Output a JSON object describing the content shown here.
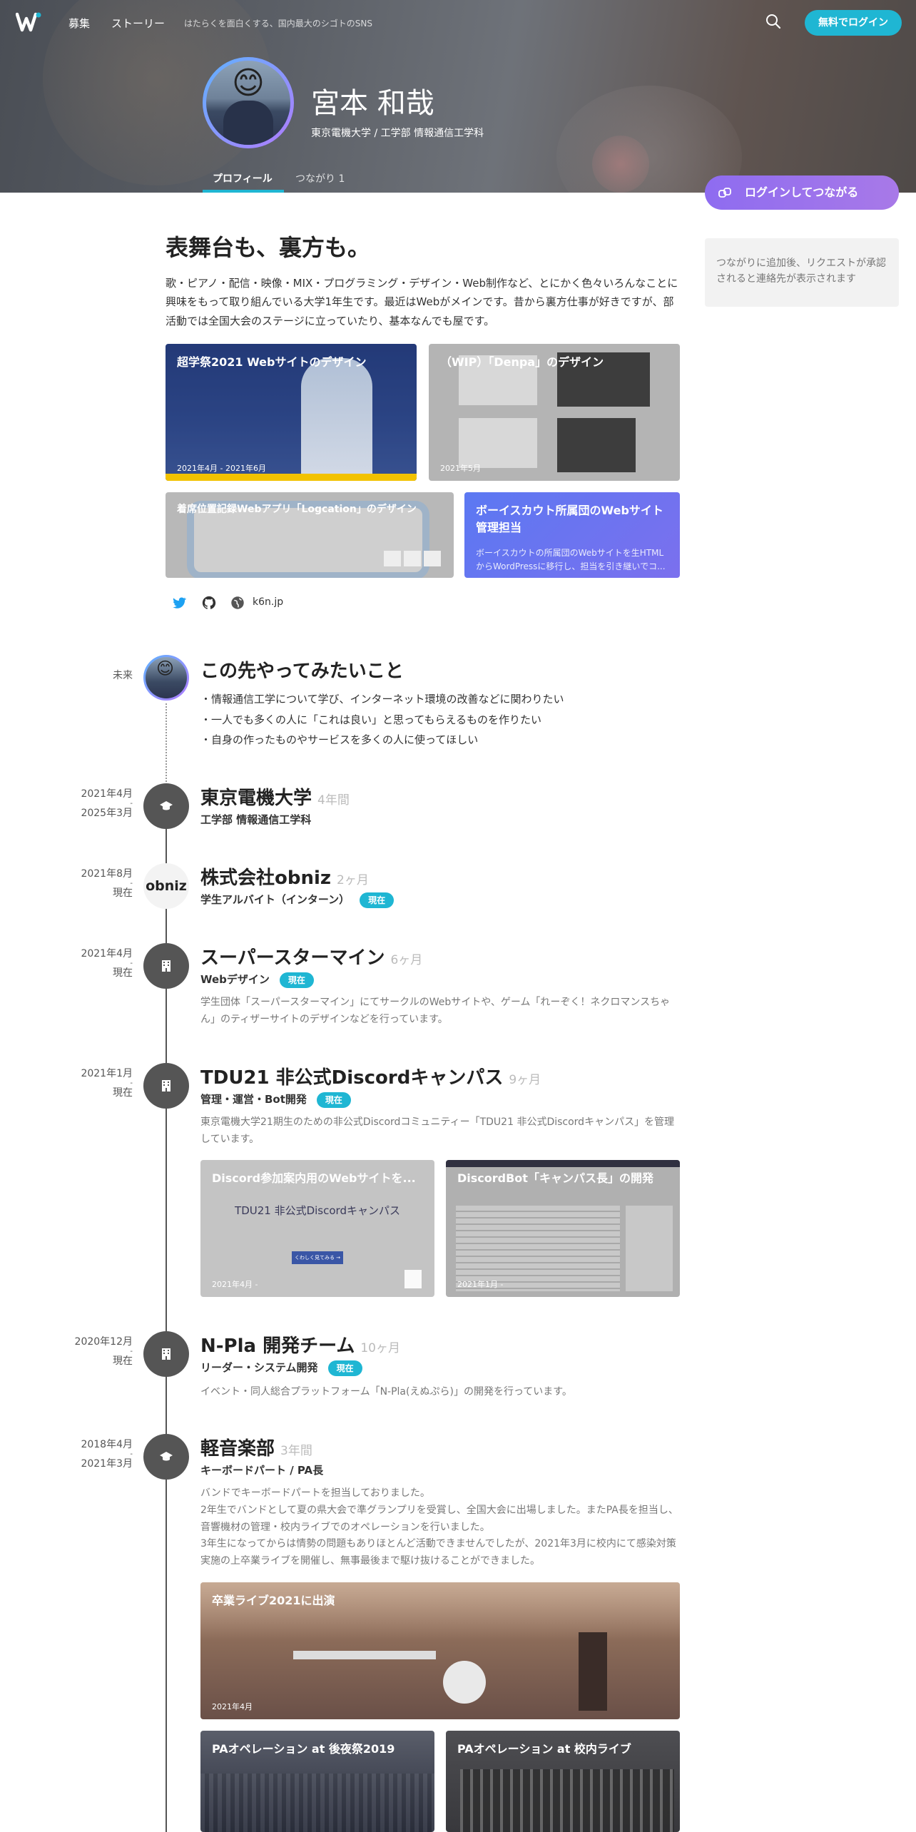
{
  "nav": {
    "links": [
      "募集",
      "ストーリー"
    ],
    "tagline": "はたらくを面白くする、国内最大のシゴトのSNS",
    "login": "無料でログイン"
  },
  "profile": {
    "name": "宮本 和哉",
    "school": "東京電機大学 / 工学部 情報通信工学科",
    "tabs": [
      "プロフィール",
      "つながり 1"
    ],
    "connect": "ログインしてつながる",
    "side_note": "つながりに追加後、リクエストが承認されると連絡先が表示されます"
  },
  "intro": {
    "catch": "表舞台も、裏方も。",
    "text": "歌・ピアノ・配信・映像・MIX・プログラミング・デザイン・Web制作など、とにかく色々いろんなことに興味をもって取り組んでいる大学1年生です。最近はWebがメインです。昔から裏方仕事が好きですが、部活動では全国大会のステージに立っていたり、基本なんでも屋です。",
    "cards": [
      {
        "title": "超学祭2021 Webサイトのデザイン",
        "date": "2021年4月 - 2021年6月"
      },
      {
        "title": "（WIP）「Denpa」のデザイン",
        "date": "2021年5月"
      },
      {
        "title": "着席位置記録Webアプリ「Logcation」のデザイン",
        "date": ""
      },
      {
        "title": "ボーイスカウト所属団のWebサイト管理担当",
        "desc": "ボーイスカウトの所属団のWebサイトを生HTMLからWordPressに移行し、担当を引き継いでコ..."
      }
    ],
    "url": "k6n.jp"
  },
  "timeline": {
    "future": {
      "date": "未来",
      "title": "この先やってみたいこと",
      "items": [
        "・情報通信工学について学び、インターネット環境の改善などに関わりたい",
        "・一人でも多くの人に「これは良い」と思ってもらえるものを作りたい",
        "・自身の作ったものやサービスを多くの人に使ってほしい"
      ]
    },
    "entries": [
      {
        "start": "2021年4月",
        "end": "2025年3月",
        "title": "東京電機大学",
        "duration": "4年間",
        "role": "工学部 情報通信工学科",
        "badge": "",
        "desc": ""
      },
      {
        "start": "2021年8月",
        "end": "現在",
        "title": "株式会社obniz",
        "duration": "2ヶ月",
        "role": "学生アルバイト（インターン）",
        "badge": "現在",
        "desc": ""
      },
      {
        "start": "2021年4月",
        "end": "現在",
        "title": "スーパースターマイン",
        "duration": "6ヶ月",
        "role": "Webデザイン",
        "badge": "現在",
        "desc": "学生団体「スーパースターマイン」にてサークルのWebサイトや、ゲーム「れーぞく！ネクロマンスちゃん」のティザーサイトのデザインなどを行っています。"
      },
      {
        "start": "2021年1月",
        "end": "現在",
        "title": "TDU21 非公式Discordキャンパス",
        "duration": "9ヶ月",
        "role": "管理・運営・Bot開発",
        "badge": "現在",
        "desc": "東京電機大学21期生のための非公式Discordコミュニティー「TDU21 非公式Discordキャンパス」を管理しています。"
      },
      {
        "start": "2020年12月",
        "end": "現在",
        "title": "N-Pla 開発チーム",
        "duration": "10ヶ月",
        "role": "リーダー・システム開発",
        "badge": "現在",
        "desc": "イベント・同人総合プラットフォーム「N-Pla(えぬぷら)」の開発を行っています。"
      },
      {
        "start": "2018年4月",
        "end": "2021年3月",
        "title": "軽音楽部",
        "duration": "3年間",
        "role": "キーボードパート / PA長",
        "badge": "",
        "desc": "バンドでキーボードパートを担当しておりました。\n2年生でバンドとして夏の県大会で準グランプリを受賞し、全国大会に出場しました。またPA長を担当し、音響機材の管理・校内ライブでのオペレーションを行いました。\n3年生になってからは情勢の問題もありほとんど活動できませんでしたが、2021年3月に校内にて感染対策実施の上卒業ライブを開催し、無事最後まで駆け抜けることができました。"
      }
    ],
    "discord_cards": [
      {
        "title": "Discord参加案内用のWebサイトを...",
        "date": "2021年4月 -",
        "inner_title": "TDU21 非公式Discordキャンパス",
        "inner_button": "くわしく見てみる →"
      },
      {
        "title": "DiscordBot「キャンパス長」の開発",
        "date": "2021年1月 -"
      }
    ],
    "band_cards": [
      {
        "title": "卒業ライブ2021に出演",
        "date": "2021年4月"
      },
      {
        "title": "PAオペレーション at 後夜祭2019"
      },
      {
        "title": "PAオペレーション at 校内ライブ"
      }
    ]
  },
  "colors": {
    "accent": "#1fb6d3",
    "connect": "#9370ee",
    "timeline_icon": "#555555"
  }
}
